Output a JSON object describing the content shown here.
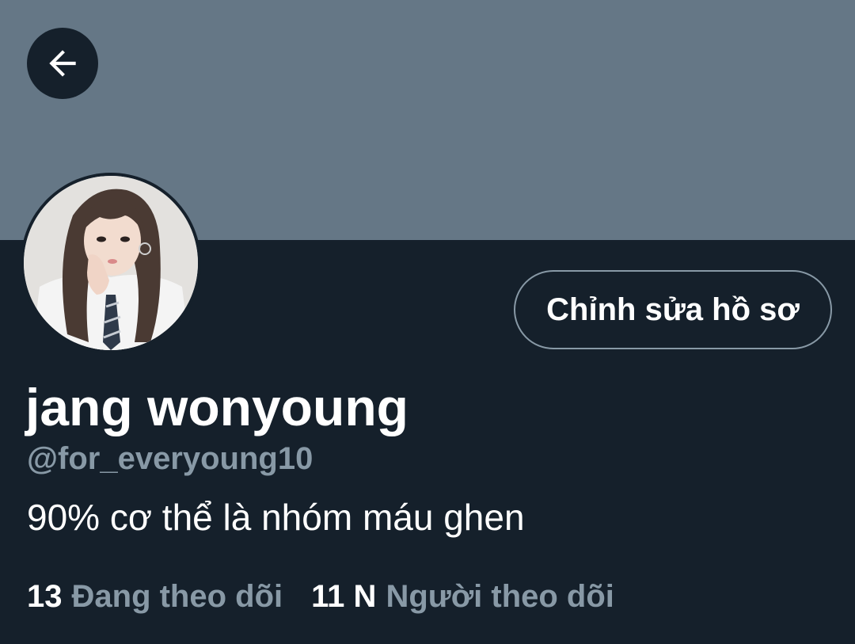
{
  "header": {
    "back_icon": "arrow-left-icon"
  },
  "profile": {
    "display_name": "jang wonyoung",
    "handle": "@for_everyoung10",
    "bio": "90% cơ thể là nhóm máu ghen",
    "edit_button_label": "Chỉnh sửa hồ sơ"
  },
  "stats": {
    "following_count": "13",
    "following_label": "Đang theo dõi",
    "followers_count": "11 N",
    "followers_label": "Người theo dõi"
  },
  "colors": {
    "background": "#15202b",
    "banner": "#657786",
    "text_primary": "#ffffff",
    "text_secondary": "#8899a6",
    "button_border": "#8899a6"
  }
}
